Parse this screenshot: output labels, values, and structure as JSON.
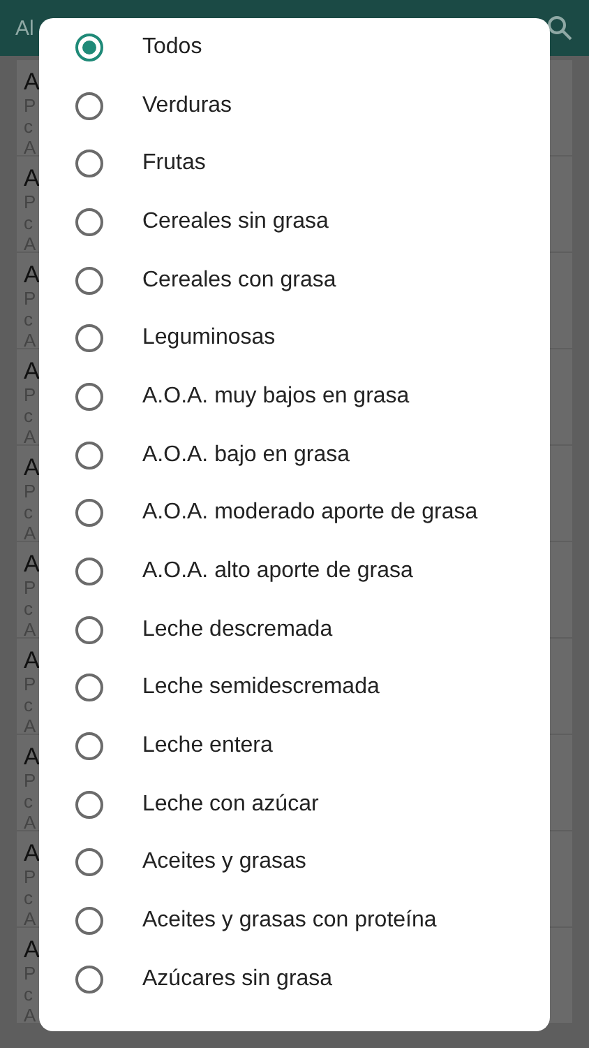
{
  "app_bar": {
    "title": "Al"
  },
  "cards": [
    {
      "title": "A",
      "lines": [
        "P",
        "c",
        "A"
      ]
    },
    {
      "title": "A",
      "lines": [
        "P",
        "c",
        "A"
      ]
    },
    {
      "title": "A",
      "lines": [
        "P",
        "c",
        "A"
      ]
    },
    {
      "title": "A",
      "lines": [
        "P",
        "c",
        "A"
      ]
    },
    {
      "title": "A",
      "lines": [
        "P",
        "c",
        "A"
      ]
    },
    {
      "title": "A",
      "lines": [
        "P",
        "c",
        "A"
      ]
    },
    {
      "title": "A",
      "lines": [
        "P",
        "c",
        "A"
      ]
    },
    {
      "title": "A",
      "lines": [
        "P",
        "c",
        "A"
      ]
    },
    {
      "title": "A",
      "lines": [
        "P",
        "c",
        "A"
      ]
    },
    {
      "title": "A",
      "lines": [
        "P",
        "c",
        "A"
      ]
    }
  ],
  "dialog": {
    "options": [
      {
        "label": "Todos",
        "selected": true
      },
      {
        "label": "Verduras",
        "selected": false
      },
      {
        "label": "Frutas",
        "selected": false
      },
      {
        "label": "Cereales sin grasa",
        "selected": false
      },
      {
        "label": "Cereales con grasa",
        "selected": false
      },
      {
        "label": "Leguminosas",
        "selected": false
      },
      {
        "label": "A.O.A. muy bajos en grasa",
        "selected": false
      },
      {
        "label": "A.O.A. bajo en grasa",
        "selected": false
      },
      {
        "label": "A.O.A. moderado aporte de grasa",
        "selected": false
      },
      {
        "label": "A.O.A. alto aporte de grasa",
        "selected": false
      },
      {
        "label": "Leche descremada",
        "selected": false
      },
      {
        "label": "Leche semidescremada",
        "selected": false
      },
      {
        "label": "Leche entera",
        "selected": false
      },
      {
        "label": "Leche con azúcar",
        "selected": false
      },
      {
        "label": "Aceites y grasas",
        "selected": false
      },
      {
        "label": "Aceites y grasas con proteína",
        "selected": false
      },
      {
        "label": "Azúcares sin grasa",
        "selected": false
      }
    ]
  }
}
